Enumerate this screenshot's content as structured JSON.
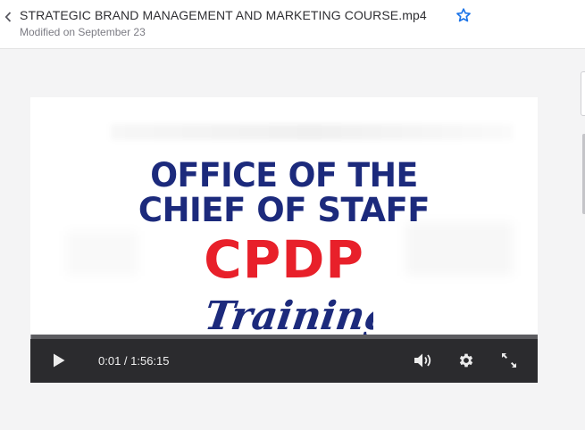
{
  "header": {
    "back_icon": "chevron-left-icon",
    "title": "STRATEGIC BRAND MANAGEMENT AND MARKETING COURSE.mp4",
    "star_icon": "star-outline-icon",
    "subtitle": "Modified on September 23"
  },
  "video": {
    "frame_text": {
      "line1": "OFFICE OF THE",
      "line2": "CHIEF OF STAFF",
      "line3": "CPDP",
      "line4": "Training"
    },
    "controls": {
      "play_icon": "play-icon",
      "time_display": "0:01 / 1:56:15",
      "progress_fraction": 0.0,
      "volume_icon": "volume-icon",
      "settings_icon": "gear-icon",
      "fullscreen_icon": "fullscreen-icon"
    }
  },
  "colors": {
    "accent": "#1a73e8",
    "frame_navy": "#1c2a7c",
    "frame_red": "#e8202a",
    "controls_bg": "#2b2b2e"
  }
}
